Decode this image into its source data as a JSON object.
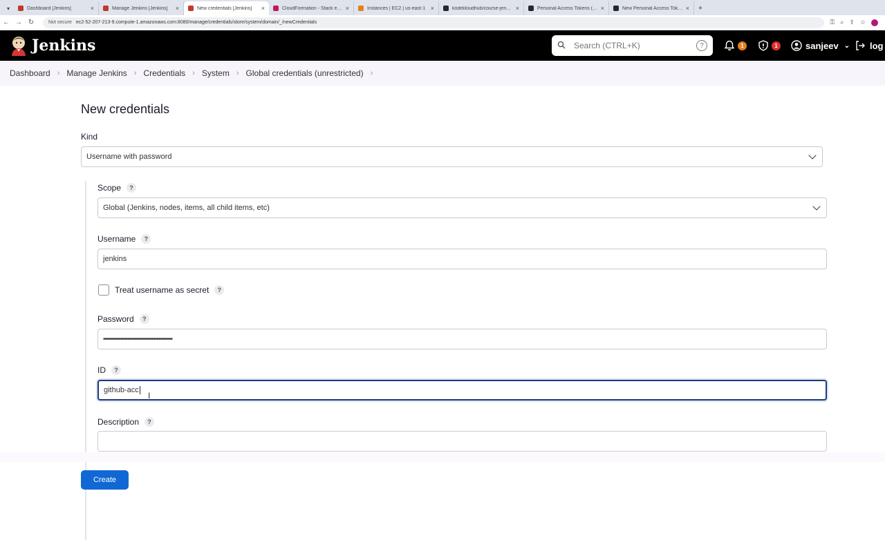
{
  "browser": {
    "tabs": [
      {
        "label": "Dashboard [Jenkins]",
        "color": "#c0392b",
        "active": false
      },
      {
        "label": "Manage Jenkins [Jenkins]",
        "color": "#c0392b",
        "active": false
      },
      {
        "label": "New credentials [Jenkins]",
        "color": "#c0392b",
        "active": true
      },
      {
        "label": "CloudFormation - Stack eksctl-...",
        "color": "#c2185b",
        "active": false
      },
      {
        "label": "Instances | EC2 | us-east-1",
        "color": "#e67e22",
        "active": false
      },
      {
        "label": "kodekloudhub/course-jenkins-...",
        "color": "#24292e",
        "active": false
      },
      {
        "label": "Personal Access Tokens (Classic)",
        "color": "#24292e",
        "active": false
      },
      {
        "label": "New Personal Access Token (Cl...",
        "color": "#24292e",
        "active": false
      }
    ],
    "not_secure": "Not secure",
    "url": "ec2-52-207-213-9.compute-1.amazonaws.com:8080/manage/credentials/store/system/domain/_/newCredentials"
  },
  "header": {
    "app_name": "Jenkins",
    "search_placeholder": "Search (CTRL+K)",
    "notifications_count": "1",
    "security_count": "1",
    "user": "sanjeev",
    "logout": "log out"
  },
  "breadcrumb": [
    "Dashboard",
    "Manage Jenkins",
    "Credentials",
    "System",
    "Global credentials (unrestricted)"
  ],
  "form": {
    "title": "New credentials",
    "kind_label": "Kind",
    "kind_value": "Username with password",
    "scope_label": "Scope",
    "scope_value": "Global (Jenkins, nodes, items, all child items, etc)",
    "username_label": "Username",
    "username_value": "jenkins",
    "treat_secret_label": "Treat username as secret",
    "password_label": "Password",
    "password_value": "••••••••••••••••••••••••••••••••••••••••",
    "id_label": "ID",
    "id_value": "github-acc",
    "description_label": "Description",
    "description_value": "",
    "help": "?",
    "create_label": "Create"
  },
  "colors": {
    "header_bg": "#000000",
    "accent_blue": "#1168d4",
    "notification_badge": "#e67e22",
    "security_badge": "#e03030"
  }
}
